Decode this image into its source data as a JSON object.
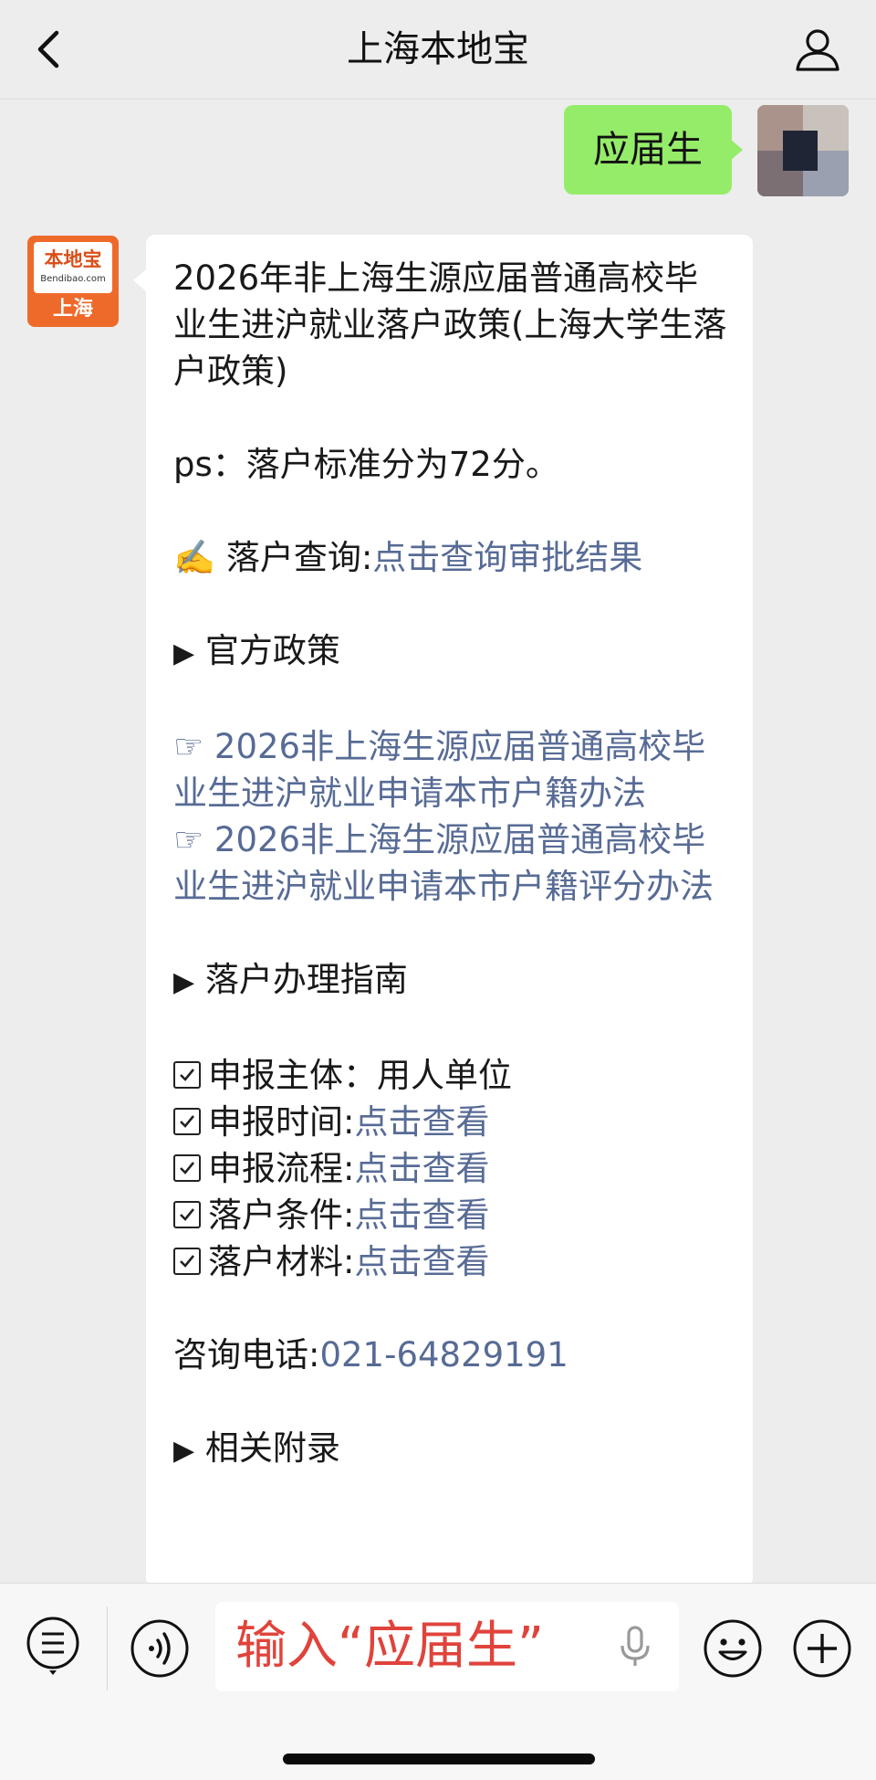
{
  "nav": {
    "title": "上海本地宝",
    "back_icon": "chevron-left-icon",
    "profile_icon": "person-icon"
  },
  "sent_message": {
    "text": "应届生"
  },
  "bot": {
    "avatar_main": "本地宝",
    "avatar_sub": "Bendibao.com",
    "avatar_city": "上海"
  },
  "reply": {
    "title": "2026年非上海生源应届普通高校毕业生进沪就业落户政策(上海大学生落户政策)",
    "ps": "ps：落户标准分为72分。",
    "query_prefix": "✍️ 落户查询:",
    "query_link": "点击查询审批结果",
    "section_official": "官方政策",
    "policy_links": [
      "☞ 2026非上海生源应届普通高校毕业生进沪就业申请本市户籍办法",
      "☞ 2026非上海生源应届普通高校毕业生进沪就业申请本市户籍评分办法"
    ],
    "section_guide": "落户办理指南",
    "checklist": [
      {
        "label": "申报主体：",
        "value": "用人单位",
        "is_link": false
      },
      {
        "label": "申报时间:",
        "value": "点击查看",
        "is_link": true
      },
      {
        "label": "申报流程:",
        "value": "点击查看",
        "is_link": true
      },
      {
        "label": "落户条件:",
        "value": "点击查看",
        "is_link": true
      },
      {
        "label": "落户材料:",
        "value": "点击查看",
        "is_link": true
      }
    ],
    "phone_label": "咨询电话:",
    "phone": "021-64829191",
    "section_appendix": "相关附录"
  },
  "input_bar": {
    "input_text": "输入“应届生”",
    "icons": [
      "menu-list-icon",
      "voice-icon",
      "microphone-icon",
      "emoji-icon",
      "plus-icon"
    ]
  },
  "colors": {
    "background": "#ededed",
    "sent_bubble": "#95ec69",
    "link": "#576b95",
    "input_text": "#e0433b",
    "bot_avatar": "#ee6a2b"
  }
}
